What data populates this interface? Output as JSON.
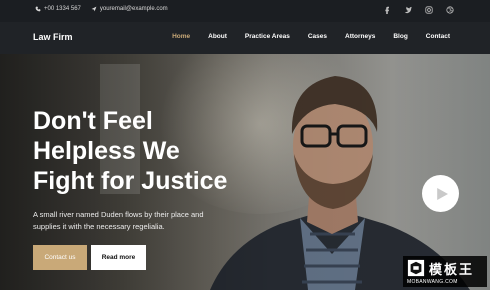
{
  "topbar": {
    "phone": "+00 1334 567",
    "email": "youremail@example.com",
    "social": [
      "facebook-icon",
      "twitter-icon",
      "instagram-icon",
      "dribbble-icon"
    ]
  },
  "nav": {
    "brand": "Law Firm",
    "items": [
      {
        "label": "Home",
        "active": true
      },
      {
        "label": "About"
      },
      {
        "label": "Practice Areas"
      },
      {
        "label": "Cases"
      },
      {
        "label": "Attorneys"
      },
      {
        "label": "Blog"
      },
      {
        "label": "Contact"
      }
    ]
  },
  "hero": {
    "headline": [
      "Don't Feel",
      "Helpless We",
      "Fight for Justice"
    ],
    "subtext": "A small river named Duden flows by their place and supplies it with the necessary regelialia.",
    "btn_contact": "Contact us",
    "btn_read": "Read more"
  },
  "colors": {
    "accent": "#c9a978",
    "dark": "#1b1e22"
  },
  "watermark": {
    "cn": "模板王",
    "en": "MOBANWANG.COM"
  }
}
